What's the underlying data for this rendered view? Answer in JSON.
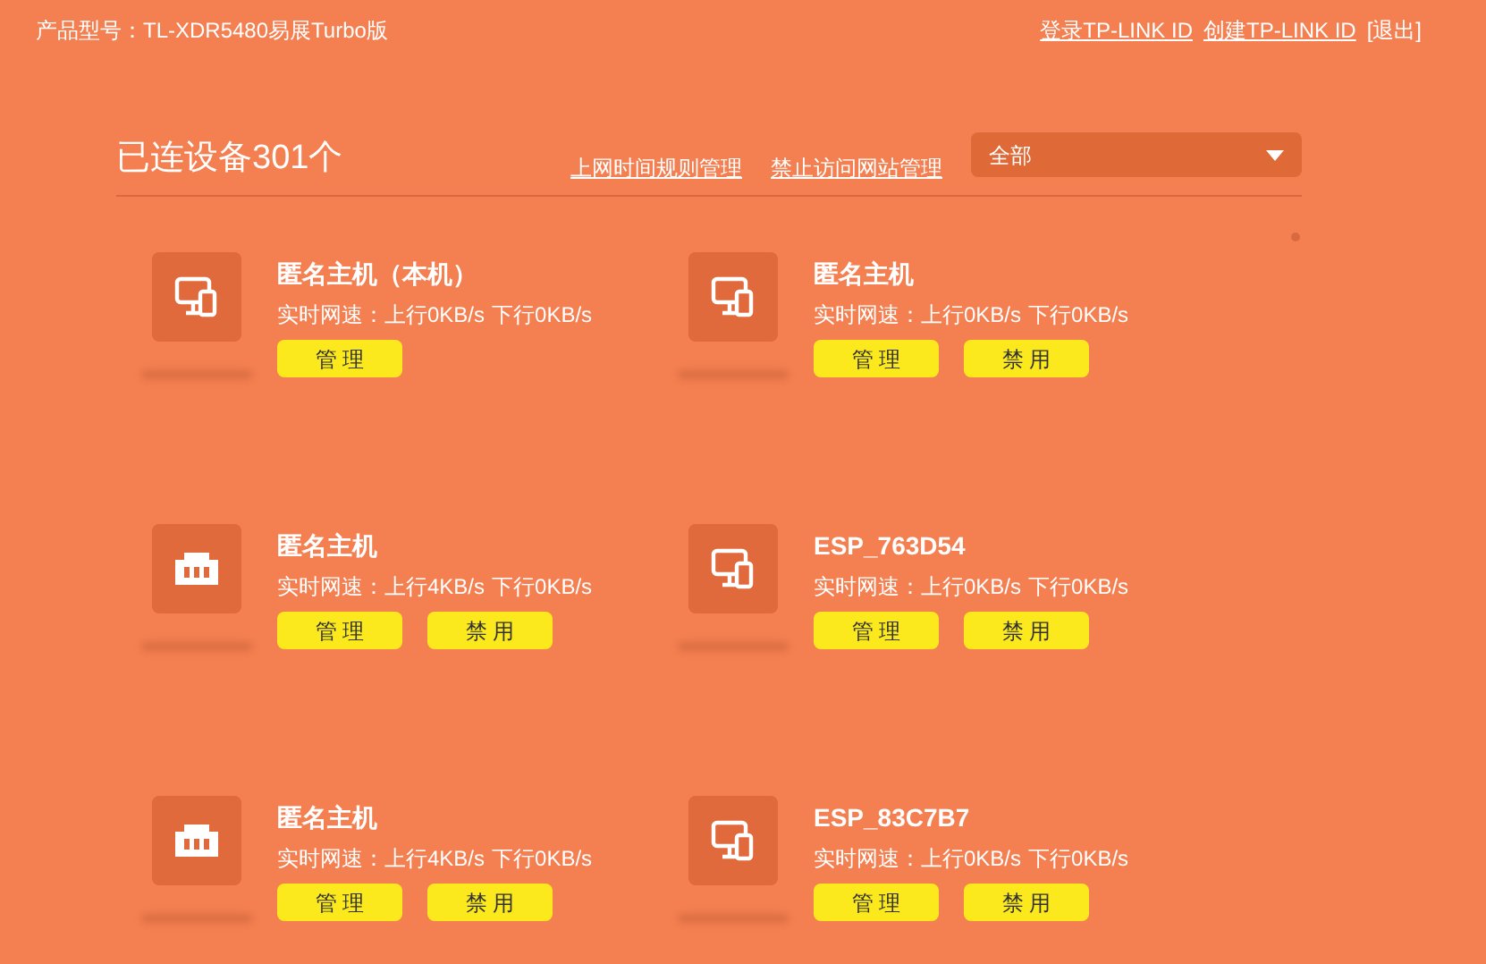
{
  "header": {
    "model": "产品型号：TL-XDR5480易展Turbo版",
    "links": [
      "登录TP-LINK ID",
      "创建TP-LINK ID",
      "[退出]"
    ]
  },
  "toolbar": {
    "title": "已连设备301个",
    "links": [
      "上网时间规则管理",
      "禁止访问网站管理"
    ],
    "filter": {
      "value": "全部"
    }
  },
  "devices": [
    {
      "kind": "pc",
      "name": "匿名主机（本机）",
      "upload": "实时网速：上行0KB/s",
      "download": "下行0KB/s",
      "buttons": [
        "管 理"
      ]
    },
    {
      "kind": "pc",
      "name": "匿名主机",
      "upload": "实时网速：上行0KB/s",
      "download": "下行0KB/s",
      "buttons": [
        "管 理",
        "禁 用"
      ]
    },
    {
      "kind": "ethernet",
      "name": "匿名主机",
      "upload": "实时网速：上行4KB/s",
      "download": "下行0KB/s",
      "buttons": [
        "管 理",
        "禁 用"
      ]
    },
    {
      "kind": "pc",
      "name": "ESP_763D54",
      "upload": "实时网速：上行0KB/s",
      "download": "下行0KB/s",
      "buttons": [
        "管 理",
        "禁 用"
      ]
    },
    {
      "kind": "ethernet",
      "name": "匿名主机",
      "upload": "实时网速：上行4KB/s",
      "download": "下行0KB/s",
      "buttons": [
        "管 理",
        "禁 用"
      ]
    },
    {
      "kind": "pc",
      "name": "ESP_83C7B7",
      "upload": "实时网速：上行0KB/s",
      "download": "下行0KB/s",
      "buttons": [
        "管 理",
        "禁 用"
      ]
    }
  ]
}
